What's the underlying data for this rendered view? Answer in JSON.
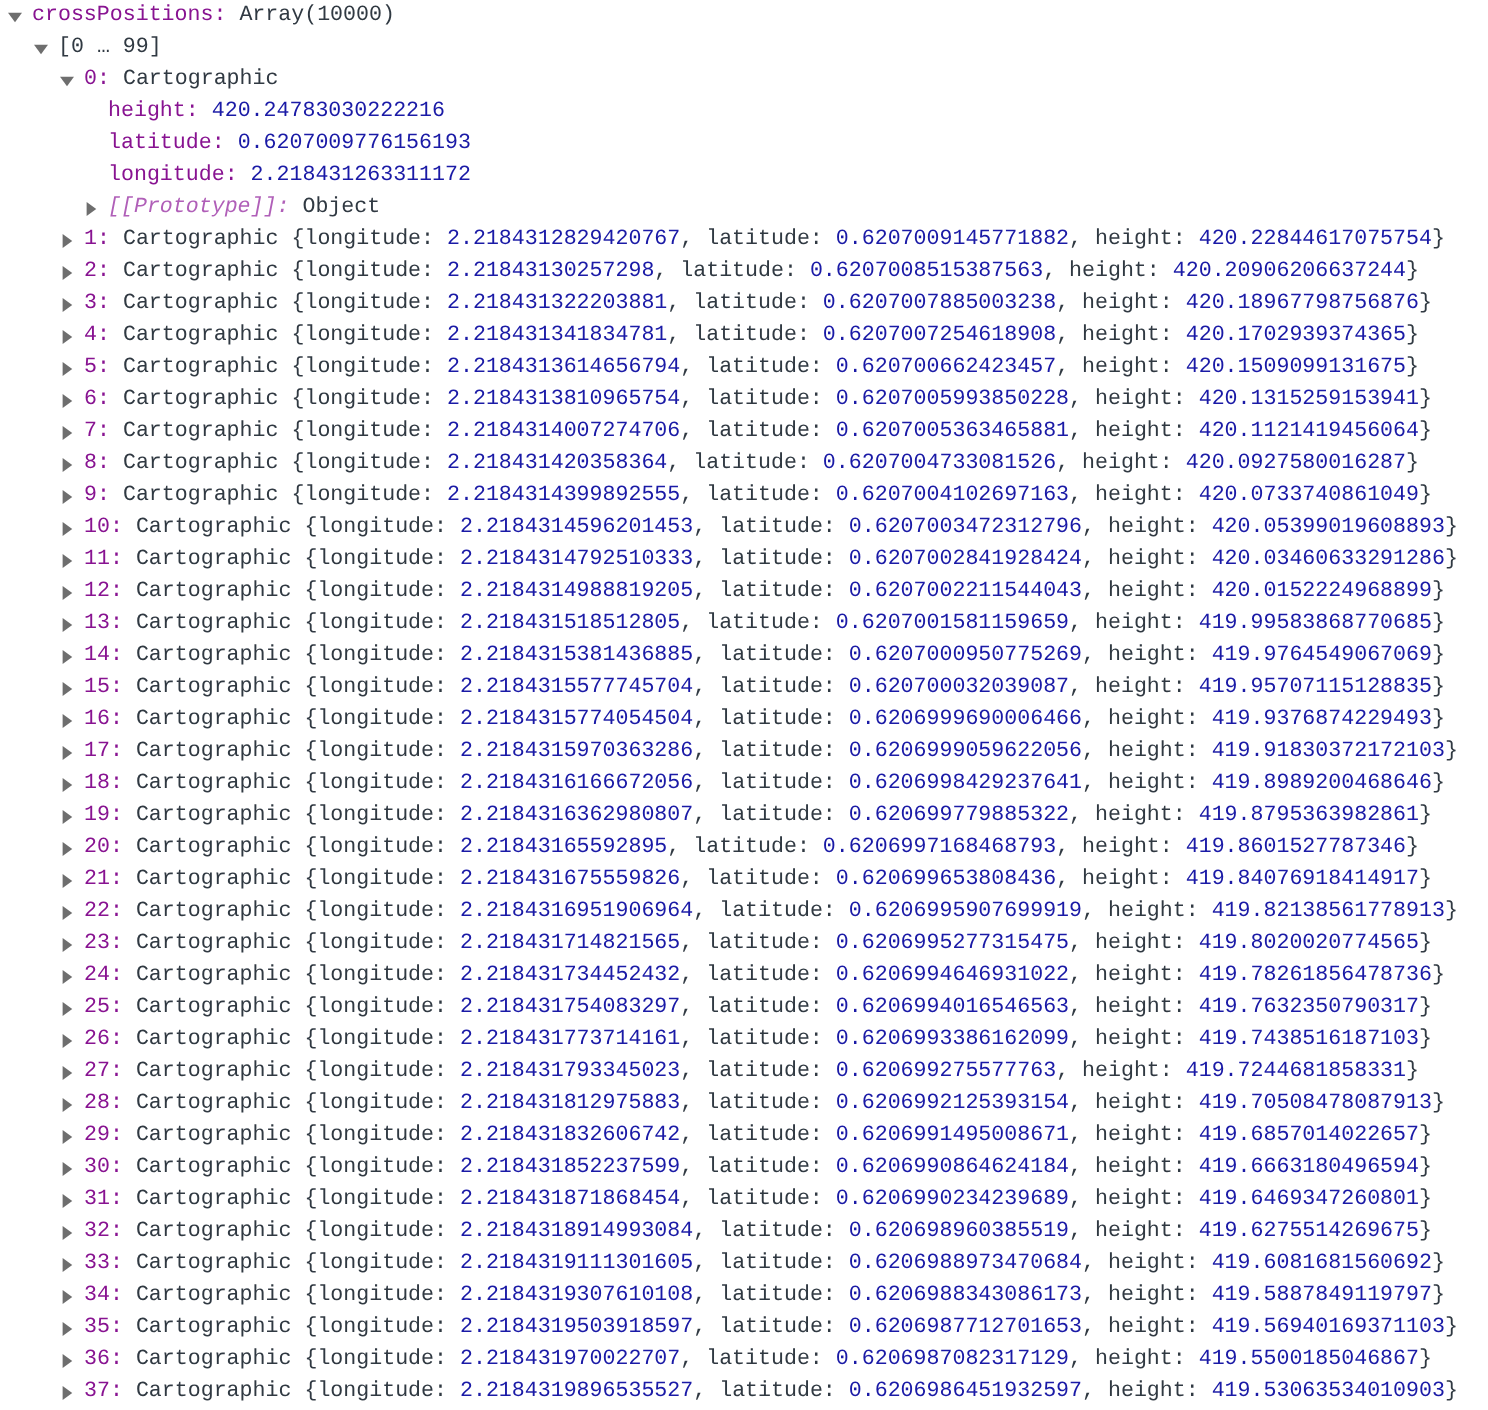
{
  "root": {
    "name": "crossPositions:",
    "summary": "Array(10000)",
    "expanded": true,
    "group": {
      "label": "[0 … 99]",
      "expanded": true,
      "items": [
        {
          "index": "0:",
          "class_name": "Cartographic",
          "expanded": true,
          "properties": [
            {
              "key": "height:",
              "value": "420.24783030222216"
            },
            {
              "key": "latitude:",
              "value": "0.6207009776156193"
            },
            {
              "key": "longitude:",
              "value": "2.218431263311172"
            }
          ],
          "prototype": {
            "key": "[[Prototype]]:",
            "value": "Object",
            "expanded": false
          }
        },
        {
          "index": "1:",
          "class_name": "Cartographic",
          "expanded": false,
          "preview": "{longitude: 2.2184312829420767, latitude: 0.6207009145771882, height: 420.22844617075754}"
        },
        {
          "index": "2:",
          "class_name": "Cartographic",
          "expanded": false,
          "preview": "{longitude: 2.21843130257298, latitude: 0.6207008515387563, height: 420.20906206637244}"
        },
        {
          "index": "3:",
          "class_name": "Cartographic",
          "expanded": false,
          "preview": "{longitude: 2.218431322203881, latitude: 0.6207007885003238, height: 420.18967798756876}"
        },
        {
          "index": "4:",
          "class_name": "Cartographic",
          "expanded": false,
          "preview": "{longitude: 2.218431341834781, latitude: 0.6207007254618908, height: 420.1702939374365}"
        },
        {
          "index": "5:",
          "class_name": "Cartographic",
          "expanded": false,
          "preview": "{longitude: 2.2184313614656794, latitude: 0.620700662423457, height: 420.1509099131675}"
        },
        {
          "index": "6:",
          "class_name": "Cartographic",
          "expanded": false,
          "preview": "{longitude: 2.2184313810965754, latitude: 0.6207005993850228, height: 420.1315259153941}"
        },
        {
          "index": "7:",
          "class_name": "Cartographic",
          "expanded": false,
          "preview": "{longitude: 2.2184314007274706, latitude: 0.6207005363465881, height: 420.1121419456064}"
        },
        {
          "index": "8:",
          "class_name": "Cartographic",
          "expanded": false,
          "preview": "{longitude: 2.218431420358364, latitude: 0.6207004733081526, height: 420.0927580016287}"
        },
        {
          "index": "9:",
          "class_name": "Cartographic",
          "expanded": false,
          "preview": "{longitude: 2.2184314399892555, latitude: 0.6207004102697163, height: 420.0733740861049}"
        },
        {
          "index": "10:",
          "class_name": "Cartographic",
          "expanded": false,
          "preview": "{longitude: 2.2184314596201453, latitude: 0.6207003472312796, height: 420.05399019608893}"
        },
        {
          "index": "11:",
          "class_name": "Cartographic",
          "expanded": false,
          "preview": "{longitude: 2.2184314792510333, latitude: 0.6207002841928424, height: 420.03460633291286}"
        },
        {
          "index": "12:",
          "class_name": "Cartographic",
          "expanded": false,
          "preview": "{longitude: 2.2184314988819205, latitude: 0.6207002211544043, height: 420.0152224968899}"
        },
        {
          "index": "13:",
          "class_name": "Cartographic",
          "expanded": false,
          "preview": "{longitude: 2.218431518512805, latitude: 0.6207001581159659, height: 419.99583868770685}"
        },
        {
          "index": "14:",
          "class_name": "Cartographic",
          "expanded": false,
          "preview": "{longitude: 2.2184315381436885, latitude: 0.6207000950775269, height: 419.9764549067069}"
        },
        {
          "index": "15:",
          "class_name": "Cartographic",
          "expanded": false,
          "preview": "{longitude: 2.2184315577745704, latitude: 0.620700032039087, height: 419.95707115128835}"
        },
        {
          "index": "16:",
          "class_name": "Cartographic",
          "expanded": false,
          "preview": "{longitude: 2.2184315774054504, latitude: 0.6206999690006466, height: 419.9376874229493}"
        },
        {
          "index": "17:",
          "class_name": "Cartographic",
          "expanded": false,
          "preview": "{longitude: 2.2184315970363286, latitude: 0.6206999059622056, height: 419.91830372172103}"
        },
        {
          "index": "18:",
          "class_name": "Cartographic",
          "expanded": false,
          "preview": "{longitude: 2.2184316166672056, latitude: 0.6206998429237641, height: 419.8989200468646}"
        },
        {
          "index": "19:",
          "class_name": "Cartographic",
          "expanded": false,
          "preview": "{longitude: 2.2184316362980807, latitude: 0.620699779885322, height: 419.8795363982861}"
        },
        {
          "index": "20:",
          "class_name": "Cartographic",
          "expanded": false,
          "preview": "{longitude: 2.21843165592895, latitude: 0.6206997168468793, height: 419.8601527787346}"
        },
        {
          "index": "21:",
          "class_name": "Cartographic",
          "expanded": false,
          "preview": "{longitude: 2.218431675559826, latitude: 0.620699653808436, height: 419.84076918414917}"
        },
        {
          "index": "22:",
          "class_name": "Cartographic",
          "expanded": false,
          "preview": "{longitude: 2.2184316951906964, latitude: 0.6206995907699919, height: 419.82138561778913}"
        },
        {
          "index": "23:",
          "class_name": "Cartographic",
          "expanded": false,
          "preview": "{longitude: 2.218431714821565, latitude: 0.6206995277315475, height: 419.8020020774565}"
        },
        {
          "index": "24:",
          "class_name": "Cartographic",
          "expanded": false,
          "preview": "{longitude: 2.218431734452432, latitude: 0.6206994646931022, height: 419.78261856478736}"
        },
        {
          "index": "25:",
          "class_name": "Cartographic",
          "expanded": false,
          "preview": "{longitude: 2.218431754083297, latitude: 0.6206994016546563, height: 419.7632350790317}"
        },
        {
          "index": "26:",
          "class_name": "Cartographic",
          "expanded": false,
          "preview": "{longitude: 2.218431773714161, latitude: 0.6206993386162099, height: 419.7438516187103}"
        },
        {
          "index": "27:",
          "class_name": "Cartographic",
          "expanded": false,
          "preview": "{longitude: 2.218431793345023, latitude: 0.620699275577763, height: 419.7244681858331}"
        },
        {
          "index": "28:",
          "class_name": "Cartographic",
          "expanded": false,
          "preview": "{longitude: 2.218431812975883, latitude: 0.6206992125393154, height: 419.70508478087913}"
        },
        {
          "index": "29:",
          "class_name": "Cartographic",
          "expanded": false,
          "preview": "{longitude: 2.218431832606742, latitude: 0.6206991495008671, height: 419.6857014022657}"
        },
        {
          "index": "30:",
          "class_name": "Cartographic",
          "expanded": false,
          "preview": "{longitude: 2.218431852237599, latitude: 0.6206990864624184, height: 419.6663180496594}"
        },
        {
          "index": "31:",
          "class_name": "Cartographic",
          "expanded": false,
          "preview": "{longitude: 2.218431871868454, latitude: 0.6206990234239689, height: 419.6469347260801}"
        },
        {
          "index": "32:",
          "class_name": "Cartographic",
          "expanded": false,
          "preview": "{longitude: 2.2184318914993084, latitude: 0.620698960385519, height: 419.6275514269675}"
        },
        {
          "index": "33:",
          "class_name": "Cartographic",
          "expanded": false,
          "preview": "{longitude: 2.2184319111301605, latitude: 0.6206988973470684, height: 419.6081681560692}"
        },
        {
          "index": "34:",
          "class_name": "Cartographic",
          "expanded": false,
          "preview": "{longitude: 2.2184319307610108, latitude: 0.6206988343086173, height: 419.5887849119797}"
        },
        {
          "index": "35:",
          "class_name": "Cartographic",
          "expanded": false,
          "preview": "{longitude: 2.2184319503918597, latitude: 0.6206987712701653, height: 419.56940169371103}"
        },
        {
          "index": "36:",
          "class_name": "Cartographic",
          "expanded": false,
          "preview": "{longitude: 2.218431970022707, latitude: 0.6206987082317129, height: 419.5500185046867}"
        },
        {
          "index": "37:",
          "class_name": "Cartographic",
          "expanded": false,
          "preview": "{longitude: 2.2184319896535527, latitude: 0.6206986451932597, height: 419.53063534010903}"
        }
      ]
    }
  }
}
